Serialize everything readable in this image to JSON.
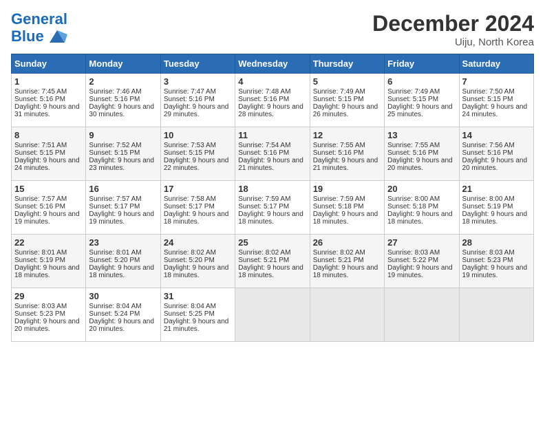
{
  "header": {
    "logo_line1": "General",
    "logo_line2": "Blue",
    "month": "December 2024",
    "location": "Uiju, North Korea"
  },
  "weekdays": [
    "Sunday",
    "Monday",
    "Tuesday",
    "Wednesday",
    "Thursday",
    "Friday",
    "Saturday"
  ],
  "weeks": [
    [
      {
        "day": "1",
        "sunrise": "Sunrise: 7:45 AM",
        "sunset": "Sunset: 5:16 PM",
        "daylight": "Daylight: 9 hours and 31 minutes."
      },
      {
        "day": "2",
        "sunrise": "Sunrise: 7:46 AM",
        "sunset": "Sunset: 5:16 PM",
        "daylight": "Daylight: 9 hours and 30 minutes."
      },
      {
        "day": "3",
        "sunrise": "Sunrise: 7:47 AM",
        "sunset": "Sunset: 5:16 PM",
        "daylight": "Daylight: 9 hours and 29 minutes."
      },
      {
        "day": "4",
        "sunrise": "Sunrise: 7:48 AM",
        "sunset": "Sunset: 5:16 PM",
        "daylight": "Daylight: 9 hours and 28 minutes."
      },
      {
        "day": "5",
        "sunrise": "Sunrise: 7:49 AM",
        "sunset": "Sunset: 5:15 PM",
        "daylight": "Daylight: 9 hours and 26 minutes."
      },
      {
        "day": "6",
        "sunrise": "Sunrise: 7:49 AM",
        "sunset": "Sunset: 5:15 PM",
        "daylight": "Daylight: 9 hours and 25 minutes."
      },
      {
        "day": "7",
        "sunrise": "Sunrise: 7:50 AM",
        "sunset": "Sunset: 5:15 PM",
        "daylight": "Daylight: 9 hours and 24 minutes."
      }
    ],
    [
      {
        "day": "8",
        "sunrise": "Sunrise: 7:51 AM",
        "sunset": "Sunset: 5:15 PM",
        "daylight": "Daylight: 9 hours and 24 minutes."
      },
      {
        "day": "9",
        "sunrise": "Sunrise: 7:52 AM",
        "sunset": "Sunset: 5:15 PM",
        "daylight": "Daylight: 9 hours and 23 minutes."
      },
      {
        "day": "10",
        "sunrise": "Sunrise: 7:53 AM",
        "sunset": "Sunset: 5:15 PM",
        "daylight": "Daylight: 9 hours and 22 minutes."
      },
      {
        "day": "11",
        "sunrise": "Sunrise: 7:54 AM",
        "sunset": "Sunset: 5:16 PM",
        "daylight": "Daylight: 9 hours and 21 minutes."
      },
      {
        "day": "12",
        "sunrise": "Sunrise: 7:55 AM",
        "sunset": "Sunset: 5:16 PM",
        "daylight": "Daylight: 9 hours and 21 minutes."
      },
      {
        "day": "13",
        "sunrise": "Sunrise: 7:55 AM",
        "sunset": "Sunset: 5:16 PM",
        "daylight": "Daylight: 9 hours and 20 minutes."
      },
      {
        "day": "14",
        "sunrise": "Sunrise: 7:56 AM",
        "sunset": "Sunset: 5:16 PM",
        "daylight": "Daylight: 9 hours and 20 minutes."
      }
    ],
    [
      {
        "day": "15",
        "sunrise": "Sunrise: 7:57 AM",
        "sunset": "Sunset: 5:16 PM",
        "daylight": "Daylight: 9 hours and 19 minutes."
      },
      {
        "day": "16",
        "sunrise": "Sunrise: 7:57 AM",
        "sunset": "Sunset: 5:17 PM",
        "daylight": "Daylight: 9 hours and 19 minutes."
      },
      {
        "day": "17",
        "sunrise": "Sunrise: 7:58 AM",
        "sunset": "Sunset: 5:17 PM",
        "daylight": "Daylight: 9 hours and 18 minutes."
      },
      {
        "day": "18",
        "sunrise": "Sunrise: 7:59 AM",
        "sunset": "Sunset: 5:17 PM",
        "daylight": "Daylight: 9 hours and 18 minutes."
      },
      {
        "day": "19",
        "sunrise": "Sunrise: 7:59 AM",
        "sunset": "Sunset: 5:18 PM",
        "daylight": "Daylight: 9 hours and 18 minutes."
      },
      {
        "day": "20",
        "sunrise": "Sunrise: 8:00 AM",
        "sunset": "Sunset: 5:18 PM",
        "daylight": "Daylight: 9 hours and 18 minutes."
      },
      {
        "day": "21",
        "sunrise": "Sunrise: 8:00 AM",
        "sunset": "Sunset: 5:19 PM",
        "daylight": "Daylight: 9 hours and 18 minutes."
      }
    ],
    [
      {
        "day": "22",
        "sunrise": "Sunrise: 8:01 AM",
        "sunset": "Sunset: 5:19 PM",
        "daylight": "Daylight: 9 hours and 18 minutes."
      },
      {
        "day": "23",
        "sunrise": "Sunrise: 8:01 AM",
        "sunset": "Sunset: 5:20 PM",
        "daylight": "Daylight: 9 hours and 18 minutes."
      },
      {
        "day": "24",
        "sunrise": "Sunrise: 8:02 AM",
        "sunset": "Sunset: 5:20 PM",
        "daylight": "Daylight: 9 hours and 18 minutes."
      },
      {
        "day": "25",
        "sunrise": "Sunrise: 8:02 AM",
        "sunset": "Sunset: 5:21 PM",
        "daylight": "Daylight: 9 hours and 18 minutes."
      },
      {
        "day": "26",
        "sunrise": "Sunrise: 8:02 AM",
        "sunset": "Sunset: 5:21 PM",
        "daylight": "Daylight: 9 hours and 18 minutes."
      },
      {
        "day": "27",
        "sunrise": "Sunrise: 8:03 AM",
        "sunset": "Sunset: 5:22 PM",
        "daylight": "Daylight: 9 hours and 19 minutes."
      },
      {
        "day": "28",
        "sunrise": "Sunrise: 8:03 AM",
        "sunset": "Sunset: 5:23 PM",
        "daylight": "Daylight: 9 hours and 19 minutes."
      }
    ],
    [
      {
        "day": "29",
        "sunrise": "Sunrise: 8:03 AM",
        "sunset": "Sunset: 5:23 PM",
        "daylight": "Daylight: 9 hours and 20 minutes."
      },
      {
        "day": "30",
        "sunrise": "Sunrise: 8:04 AM",
        "sunset": "Sunset: 5:24 PM",
        "daylight": "Daylight: 9 hours and 20 minutes."
      },
      {
        "day": "31",
        "sunrise": "Sunrise: 8:04 AM",
        "sunset": "Sunset: 5:25 PM",
        "daylight": "Daylight: 9 hours and 21 minutes."
      },
      null,
      null,
      null,
      null
    ]
  ]
}
